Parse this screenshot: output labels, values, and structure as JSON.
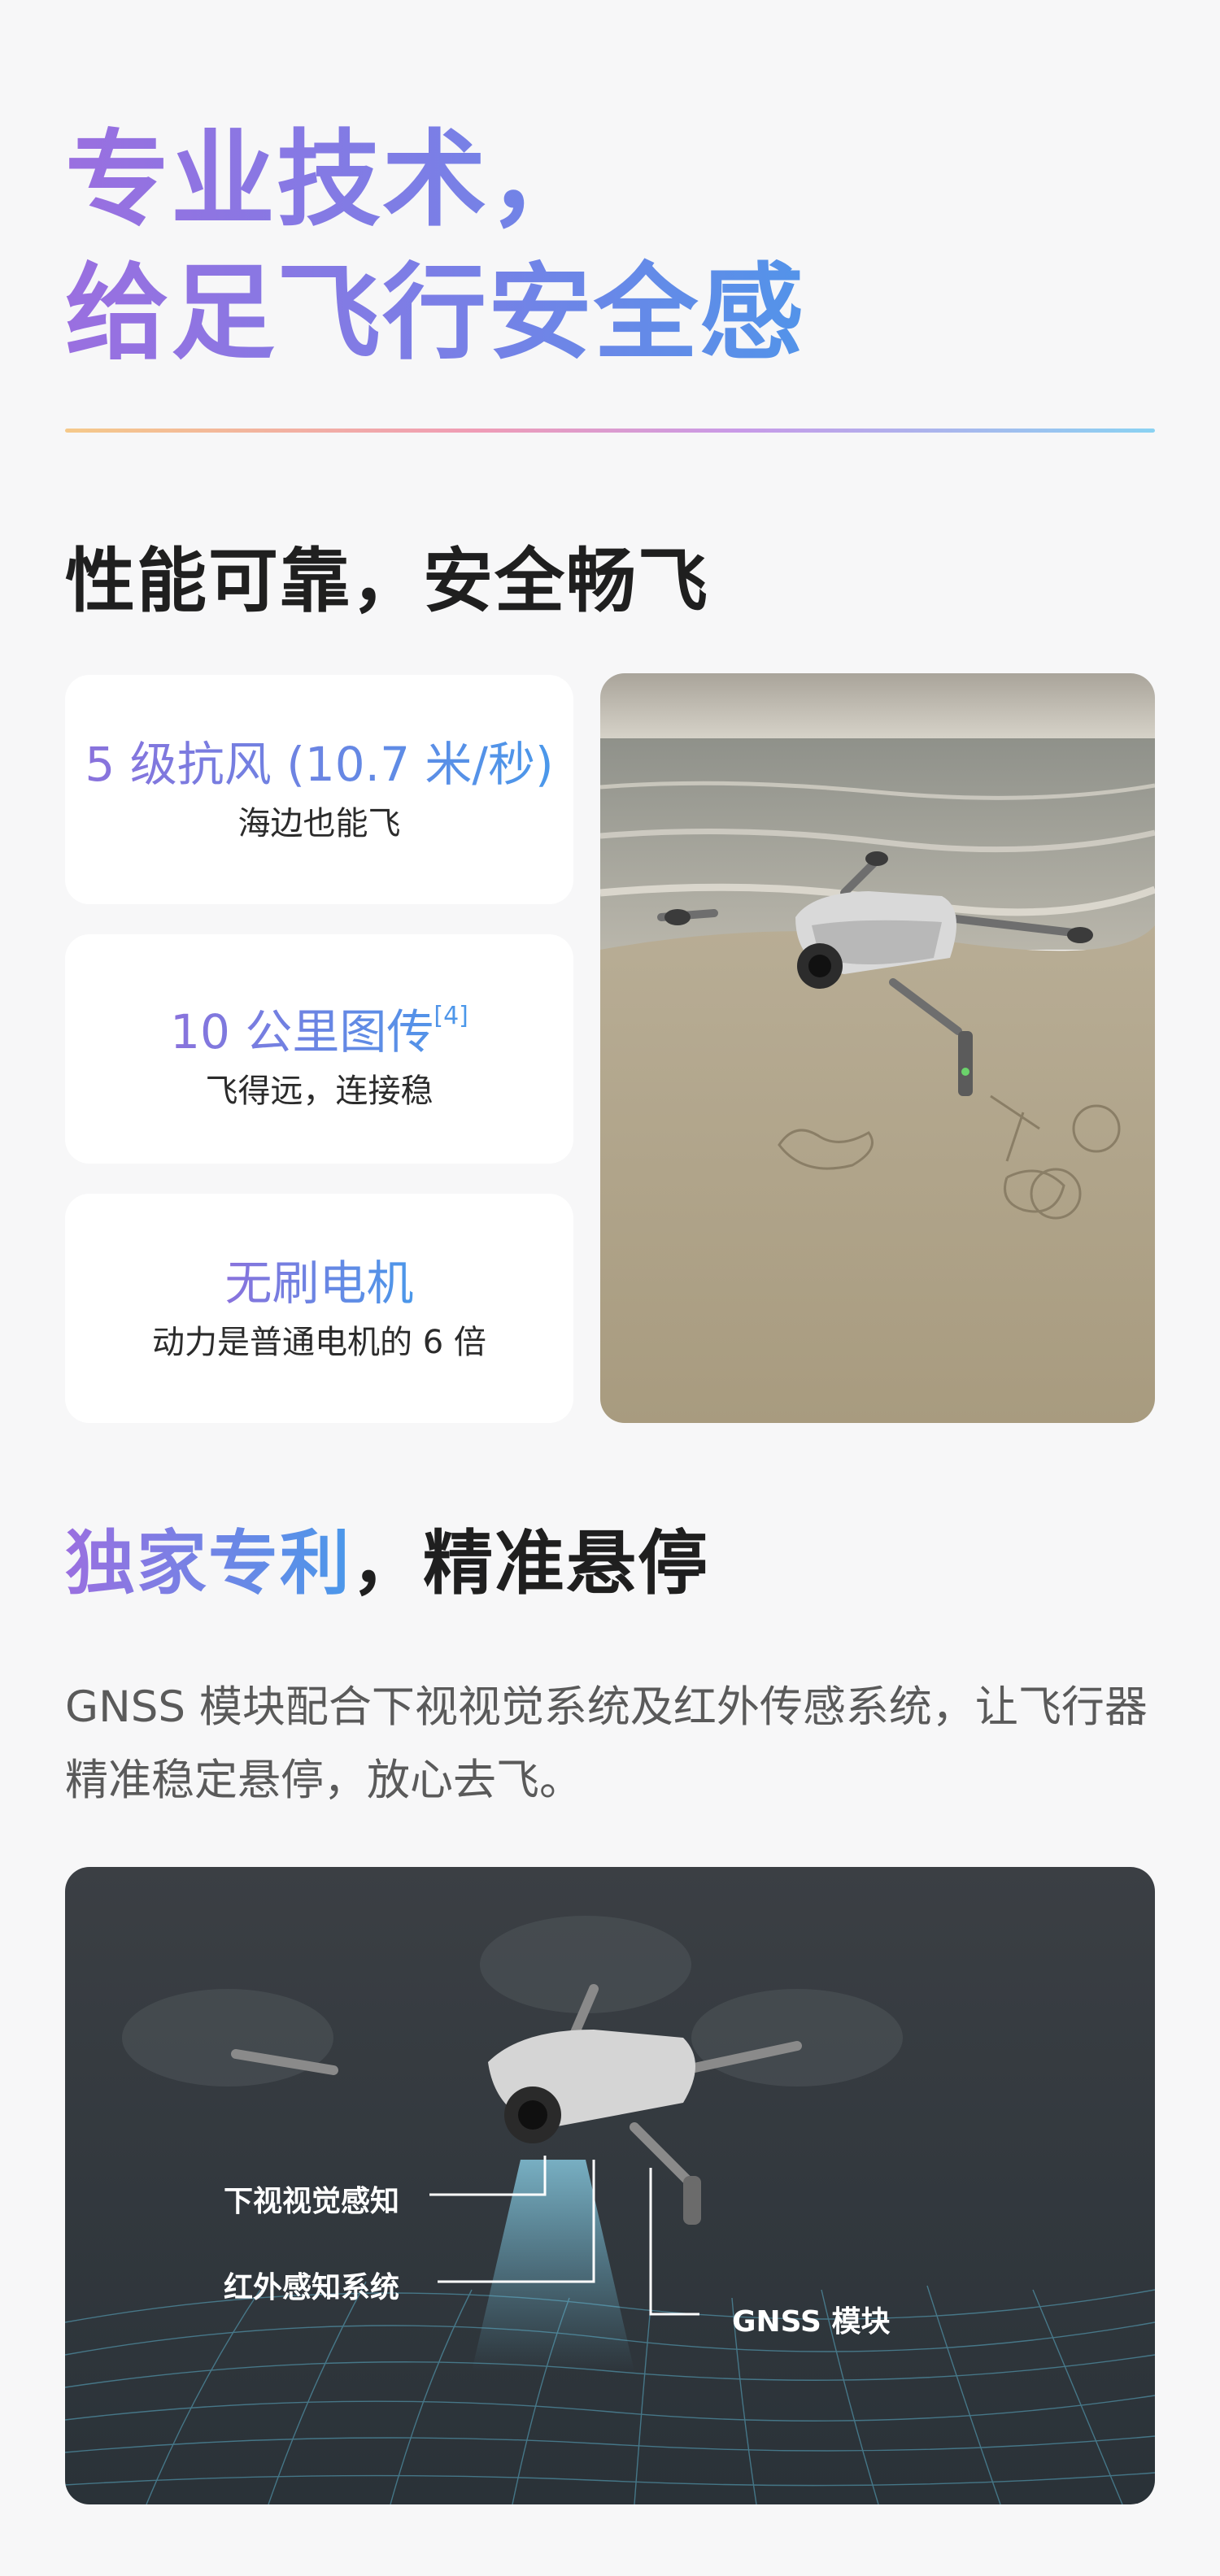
{
  "hero": {
    "line1": "专业技术，",
    "line2": "给足飞行安全感"
  },
  "performance": {
    "title": "性能可靠，安全畅飞",
    "cards": [
      {
        "title": "5 级抗风 (10.7 米/秒)",
        "subtitle": "海边也能飞"
      },
      {
        "title": "10 公里图传",
        "footnote": "[4]",
        "subtitle": "飞得远，连接稳"
      },
      {
        "title": "无刷电机",
        "subtitle": "动力是普通电机的 6 倍"
      }
    ]
  },
  "hover": {
    "title_highlight": "独家专利",
    "title_rest": "，精准悬停",
    "description": "GNSS 模块配合下视视觉系统及红外传感系统，让飞行器精准稳定悬停，放心去飞。",
    "labels": {
      "downward_vision": "下视视觉感知",
      "infrared": "红外感知系统",
      "gnss": "GNSS 模块"
    }
  }
}
